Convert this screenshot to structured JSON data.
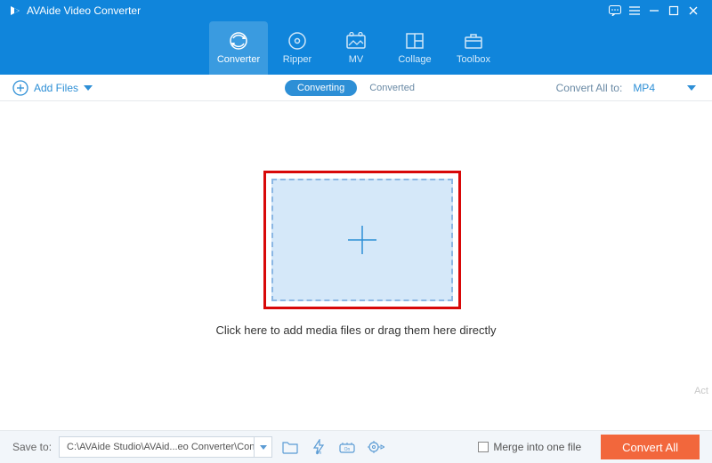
{
  "titlebar": {
    "title": "AVAide Video Converter"
  },
  "nav": {
    "converter": "Converter",
    "ripper": "Ripper",
    "mv": "MV",
    "collage": "Collage",
    "toolbox": "Toolbox"
  },
  "subbar": {
    "add_files": "Add Files",
    "converting": "Converting",
    "converted": "Converted",
    "convert_all_to": "Convert All to:",
    "format": "MP4"
  },
  "main": {
    "hint": "Click here to add media files or drag them here directly"
  },
  "statusbar": {
    "save_to": "Save to:",
    "path": "C:\\AVAide Studio\\AVAid...eo Converter\\Converted",
    "merge": "Merge into one file",
    "convert_all": "Convert All"
  },
  "watermark": "Act"
}
